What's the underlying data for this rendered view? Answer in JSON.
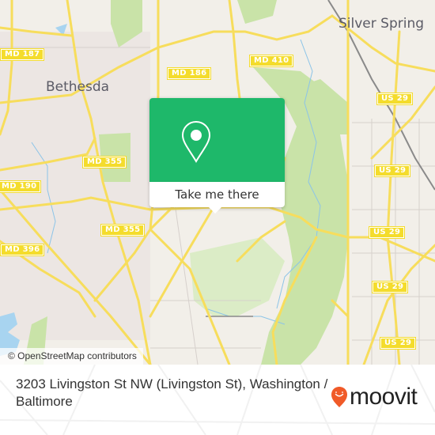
{
  "map": {
    "cities": [
      {
        "name": "Bethesda"
      },
      {
        "name": "Silver Spring"
      }
    ],
    "route_shields": [
      {
        "label": "MD 187"
      },
      {
        "label": "MD 410"
      },
      {
        "label": "MD 186"
      },
      {
        "label": "MD 355"
      },
      {
        "label": "MD 190"
      },
      {
        "label": "MD 355"
      },
      {
        "label": "MD 396"
      },
      {
        "label": "US 29"
      },
      {
        "label": "US 29"
      },
      {
        "label": "US 29"
      },
      {
        "label": "US 29"
      },
      {
        "label": "US 29"
      }
    ],
    "attribution": "© OpenStreetMap contributors",
    "colors": {
      "land": "#f2efe9",
      "park": "#c9e3a8",
      "road": "#f7dd5c",
      "water": "#a8d4f0",
      "rail": "#8a8a8a"
    }
  },
  "popup": {
    "icon": "map-pin-icon",
    "button_label": "Take me there",
    "accent_color": "#1eb86a"
  },
  "footer": {
    "address": "3203 Livingston St NW (Livingston St), Washington / Baltimore",
    "brand": "moovit",
    "brand_color": "#f05a28"
  }
}
